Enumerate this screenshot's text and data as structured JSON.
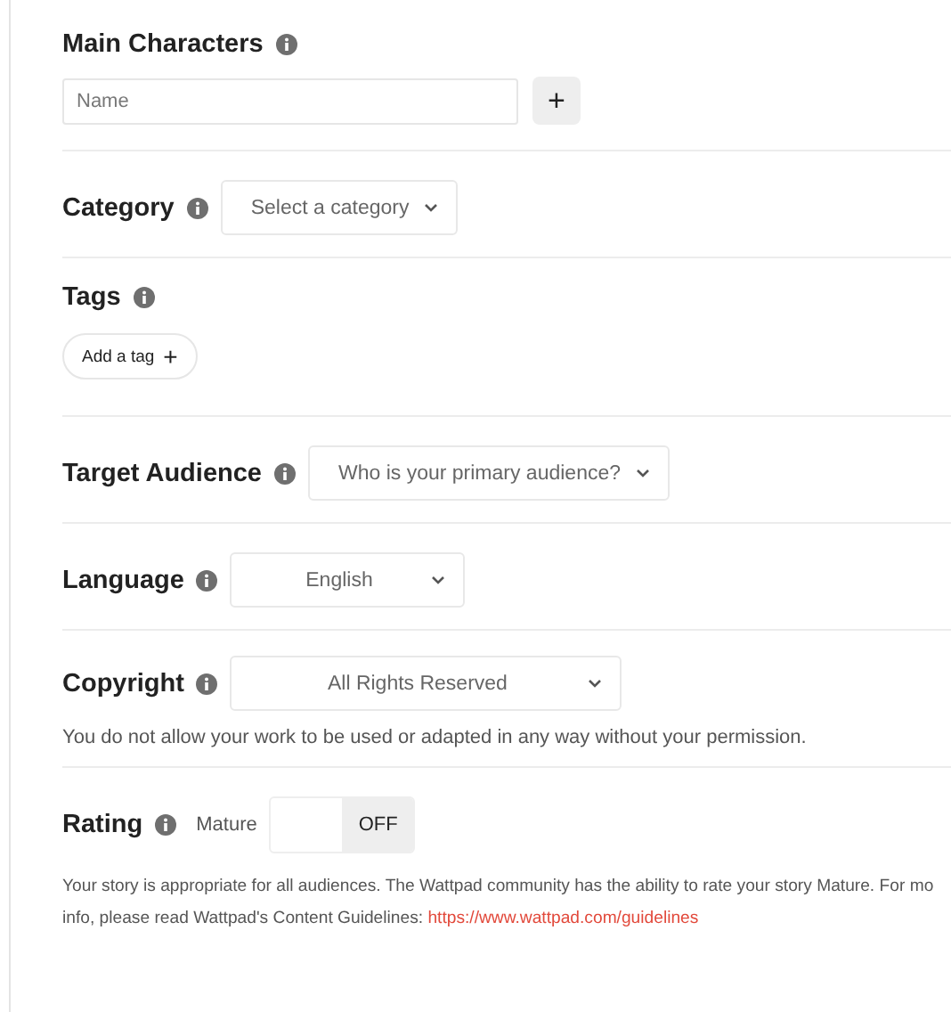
{
  "sections": [
    {
      "kind": "text_add",
      "title": "Main Characters",
      "placeholder": "Name",
      "button": "+"
    },
    {
      "kind": "select",
      "title": "Category",
      "value": "Select a category"
    },
    {
      "kind": "tags",
      "title": "Tags",
      "button": "Add a tag",
      "button_icon": "+"
    },
    {
      "kind": "select",
      "title": "Target Audience",
      "value": "Who is your primary audience?"
    },
    {
      "kind": "select",
      "title": "Language",
      "value": "English"
    },
    {
      "kind": "select",
      "title": "Copyright",
      "value": "All Rights Reserved",
      "note": "You do not allow your work to be used or adapted in any way without your permission."
    },
    {
      "kind": "toggle",
      "title": "Rating",
      "toggle_label": "Mature",
      "on": false,
      "state_text": "OFF",
      "note_lines": [
        "Your story is appropriate for all audiences. The Wattpad community has the ability to rate your story Mature. For mo",
        "info, please read Wattpad's Content Guidelines: "
      ],
      "link": "https://www.wattpad.com/guidelines"
    }
  ]
}
